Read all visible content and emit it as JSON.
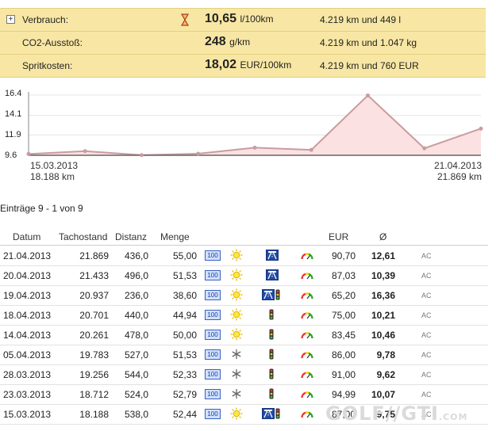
{
  "summary": [
    {
      "label": "Verbrauch:",
      "value": "10,65",
      "unit": "l/100km",
      "info": "4.219 km und 449 l",
      "icon": "hourglass-icon"
    },
    {
      "label": "CO2-Ausstoß:",
      "value": "248",
      "unit": "g/km",
      "info": "4.219 km und 1.047 kg"
    },
    {
      "label": "Spritkosten:",
      "value": "18,02",
      "unit": "EUR/100km",
      "info": "4.219 km und 760 EUR"
    }
  ],
  "chart_data": {
    "type": "area",
    "yticks": [
      "16.4",
      "14.1",
      "11.9",
      "9.6"
    ],
    "ylim": [
      9.6,
      16.4
    ],
    "x_labels": [
      {
        "date": "15.03.2013",
        "km": "18.188 km"
      },
      {
        "date": "21.04.2013",
        "km": "21.869 km"
      }
    ],
    "series": [
      {
        "values": [
          9.75,
          10.07,
          9.62,
          9.78,
          10.46,
          10.21,
          16.36,
          10.39,
          12.61
        ]
      }
    ],
    "colors": {
      "line": "#c99ca0",
      "fill": "#fbe1e1"
    }
  },
  "entries_text": "Einträge 9 - 1 von 9",
  "table": {
    "headers": {
      "datum": "Datum",
      "tacho": "Tachostand",
      "distanz": "Distanz",
      "menge": "Menge",
      "eur": "EUR",
      "avg": "Ø"
    },
    "rows": [
      {
        "datum": "21.04.2013",
        "tacho": "21.869",
        "distanz": "436,0",
        "menge": "55,00",
        "octane": "100",
        "weather": "sun",
        "road": "highway",
        "eur": "90,70",
        "avg": "12,61",
        "ac": "AC"
      },
      {
        "datum": "20.04.2013",
        "tacho": "21.433",
        "distanz": "496,0",
        "menge": "51,53",
        "octane": "100",
        "weather": "sun",
        "road": "highway",
        "eur": "87,03",
        "avg": "10,39",
        "ac": "AC"
      },
      {
        "datum": "19.04.2013",
        "tacho": "20.937",
        "distanz": "236,0",
        "menge": "38,60",
        "octane": "100",
        "weather": "sun",
        "road": "highway-city",
        "eur": "65,20",
        "avg": "16,36",
        "ac": "AC"
      },
      {
        "datum": "18.04.2013",
        "tacho": "20.701",
        "distanz": "440,0",
        "menge": "44,94",
        "octane": "100",
        "weather": "sun",
        "road": "city",
        "eur": "75,00",
        "avg": "10,21",
        "ac": "AC"
      },
      {
        "datum": "14.04.2013",
        "tacho": "20.261",
        "distanz": "478,0",
        "menge": "50,00",
        "octane": "100",
        "weather": "sun",
        "road": "city",
        "eur": "83,45",
        "avg": "10,46",
        "ac": "AC"
      },
      {
        "datum": "05.04.2013",
        "tacho": "19.783",
        "distanz": "527,0",
        "menge": "51,53",
        "octane": "100",
        "weather": "snow",
        "road": "city",
        "eur": "86,00",
        "avg": "9,78",
        "ac": "AC"
      },
      {
        "datum": "28.03.2013",
        "tacho": "19.256",
        "distanz": "544,0",
        "menge": "52,33",
        "octane": "100",
        "weather": "snow",
        "road": "city",
        "eur": "91,00",
        "avg": "9,62",
        "ac": "AC"
      },
      {
        "datum": "23.03.2013",
        "tacho": "18.712",
        "distanz": "524,0",
        "menge": "52,79",
        "octane": "100",
        "weather": "snow",
        "road": "city",
        "eur": "94,99",
        "avg": "10,07",
        "ac": "AC"
      },
      {
        "datum": "15.03.2013",
        "tacho": "18.188",
        "distanz": "538,0",
        "menge": "52,44",
        "octane": "100",
        "weather": "sun",
        "road": "highway-city",
        "eur": "87,00",
        "avg": "9,75",
        "ac": "AC"
      }
    ]
  },
  "watermark": {
    "text": "GOLF//GTI",
    "suffix": ".COM"
  }
}
